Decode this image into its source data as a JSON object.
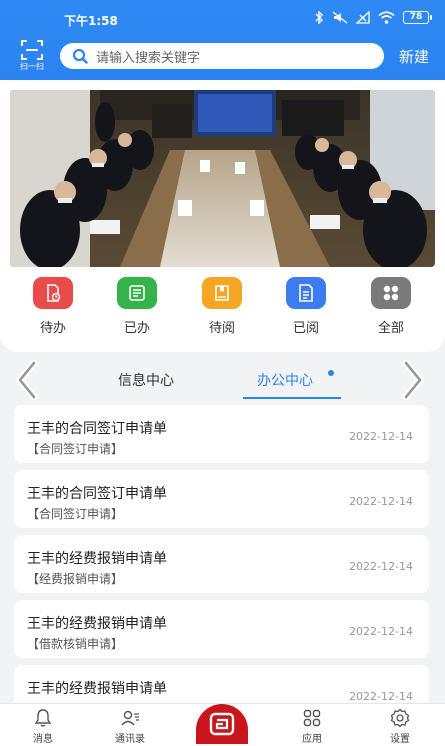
{
  "status_bar": {
    "time": "下午1:58",
    "battery": "78"
  },
  "header": {
    "scan_label": "扫一扫",
    "search_placeholder": "请输入搜索关键字",
    "new_label": "新建"
  },
  "quick_actions": [
    {
      "label": "待办",
      "icon": "pending-doc-icon",
      "color": "#e94b4b"
    },
    {
      "label": "已办",
      "icon": "done-list-icon",
      "color": "#35b24a"
    },
    {
      "label": "待阅",
      "icon": "book-icon",
      "color": "#f5a623"
    },
    {
      "label": "已阅",
      "icon": "read-doc-icon",
      "color": "#3d7bf0"
    },
    {
      "label": "全部",
      "icon": "grid-icon",
      "color": "#7a7a7a"
    }
  ],
  "tabs": [
    {
      "label": "信息中心",
      "active": false
    },
    {
      "label": "办公中心",
      "active": true
    }
  ],
  "list": [
    {
      "title": "王丰的合同签订申请单",
      "category": "【合同签订申请】",
      "date": "2022-12-14"
    },
    {
      "title": "王丰的合同签订申请单",
      "category": "【合同签订申请】",
      "date": "2022-12-14"
    },
    {
      "title": "王丰的经费报销申请单",
      "category": "【经费报销申请】",
      "date": "2022-12-14"
    },
    {
      "title": "王丰的经费报销申请单",
      "category": "【借款核销申请】",
      "date": "2022-12-14"
    },
    {
      "title": "王丰的经费报销申请单",
      "category": "",
      "date": "2022-12-14"
    }
  ],
  "bottom_nav": [
    {
      "label": "消息",
      "icon": "bell-icon"
    },
    {
      "label": "通讯录",
      "icon": "contacts-icon"
    },
    {
      "label": "应用",
      "icon": "apps-icon"
    },
    {
      "label": "设置",
      "icon": "settings-icon"
    }
  ],
  "colors": {
    "primary": "#2a83f0",
    "center_button": "#c8151b"
  }
}
